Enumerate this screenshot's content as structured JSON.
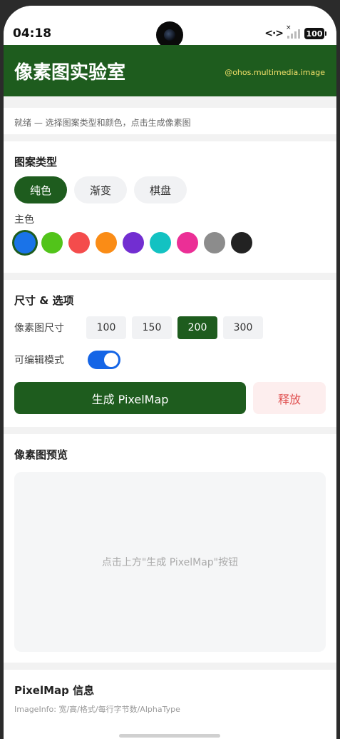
{
  "status_bar": {
    "time": "04:18",
    "network_label": "<·>",
    "battery": "100"
  },
  "header": {
    "title": "像素图实验室",
    "subtitle": "@ohos.multimedia.image"
  },
  "status": {
    "text": "就绪 — 选择图案类型和颜色，点击生成像素图"
  },
  "pattern": {
    "title": "图案类型",
    "types": [
      {
        "label": "纯色",
        "active": true
      },
      {
        "label": "渐变",
        "active": false
      },
      {
        "label": "棋盘",
        "active": false
      }
    ],
    "color_label": "主色",
    "colors": [
      "#1a73e8",
      "#52c41a",
      "#f44c4c",
      "#fa8c16",
      "#722ed1",
      "#13c2c2",
      "#eb2f96",
      "#8c8c8c",
      "#222222"
    ],
    "selected_color_index": 0
  },
  "size": {
    "title": "尺寸 & 选项",
    "size_label": "像素图尺寸",
    "options": [
      {
        "label": "100",
        "active": false
      },
      {
        "label": "150",
        "active": false
      },
      {
        "label": "200",
        "active": true
      },
      {
        "label": "300",
        "active": false
      }
    ],
    "editable_label": "可编辑模式",
    "editable_on": true,
    "generate_label": "生成 PixelMap",
    "release_label": "释放"
  },
  "preview": {
    "title": "像素图预览",
    "placeholder": "点击上方\"生成 PixelMap\"按钮"
  },
  "info": {
    "title": "PixelMap 信息",
    "subtitle": "ImageInfo: 宽/高/格式/每行字节数/AlphaType"
  }
}
